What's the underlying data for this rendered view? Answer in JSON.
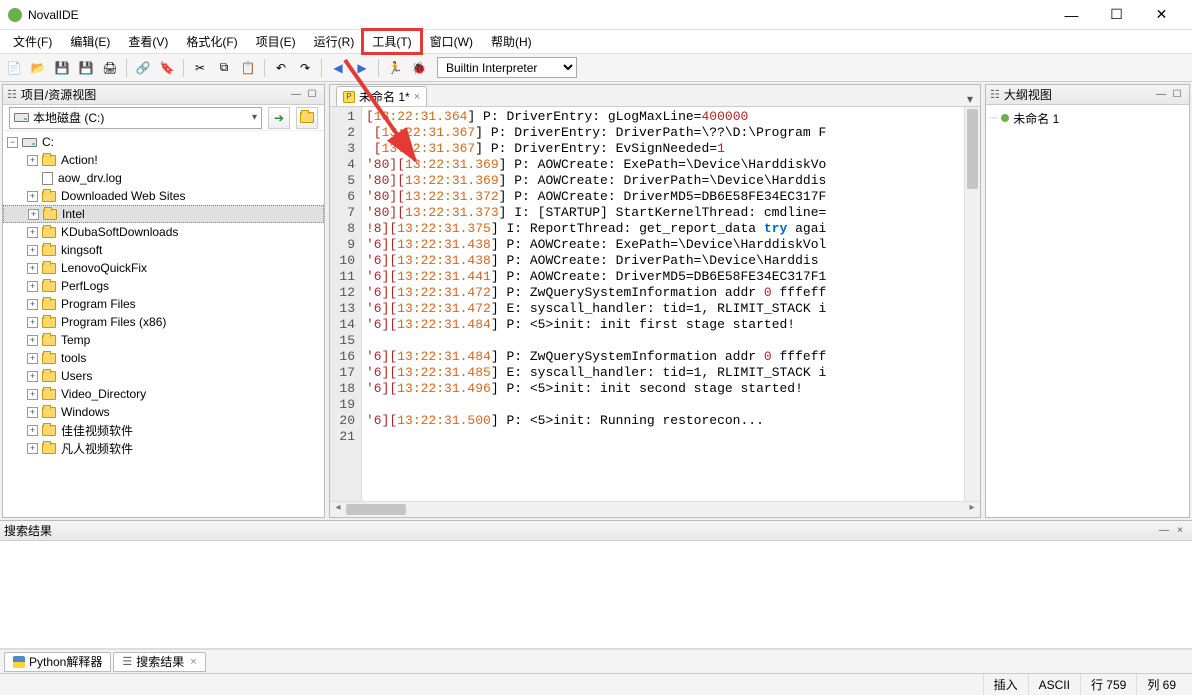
{
  "app": {
    "title": "NovalIDE"
  },
  "window_controls": {
    "min": "—",
    "max": "☐",
    "close": "✕"
  },
  "menu": [
    {
      "key": "file",
      "label": "文件(F)"
    },
    {
      "key": "edit",
      "label": "编辑(E)"
    },
    {
      "key": "view",
      "label": "查看(V)"
    },
    {
      "key": "format",
      "label": "格式化(F)"
    },
    {
      "key": "project",
      "label": "项目(E)"
    },
    {
      "key": "run",
      "label": "运行(R)"
    },
    {
      "key": "tools",
      "label": "工具(T)",
      "highlighted": true
    },
    {
      "key": "window",
      "label": "窗口(W)"
    },
    {
      "key": "help",
      "label": "帮助(H)"
    }
  ],
  "toolbar": {
    "interpreter_selected": "Builtin Interpreter",
    "icons": [
      "new-file-icon",
      "open-folder-icon",
      "save-icon",
      "save-all-icon",
      "print-icon",
      "sep",
      "goto-icon",
      "bookmark-icon",
      "sep",
      "cut-icon",
      "copy-icon",
      "paste-icon",
      "sep",
      "undo-icon",
      "redo-icon",
      "sep",
      "nav-back-icon",
      "nav-fwd-icon",
      "sep",
      "run-icon",
      "bug-icon"
    ]
  },
  "left_panel": {
    "title": "项目/资源视图",
    "drive_label": "本地磁盘 (C:)",
    "tree_root_label": "C:",
    "nodes": [
      {
        "type": "folder",
        "label": "Action!",
        "expandable": true
      },
      {
        "type": "file",
        "label": "aow_drv.log",
        "expandable": false
      },
      {
        "type": "folder",
        "label": "Downloaded Web Sites",
        "expandable": true
      },
      {
        "type": "folder",
        "label": "Intel",
        "expandable": true,
        "selected": true
      },
      {
        "type": "folder",
        "label": "KDubaSoftDownloads",
        "expandable": true
      },
      {
        "type": "folder",
        "label": "kingsoft",
        "expandable": true
      },
      {
        "type": "folder",
        "label": "LenovoQuickFix",
        "expandable": true
      },
      {
        "type": "folder",
        "label": "PerfLogs",
        "expandable": true
      },
      {
        "type": "folder",
        "label": "Program Files",
        "expandable": true
      },
      {
        "type": "folder",
        "label": "Program Files (x86)",
        "expandable": true
      },
      {
        "type": "folder",
        "label": "Temp",
        "expandable": true
      },
      {
        "type": "folder",
        "label": "tools",
        "expandable": true
      },
      {
        "type": "folder",
        "label": "Users",
        "expandable": true
      },
      {
        "type": "folder",
        "label": "Video_Directory",
        "expandable": true
      },
      {
        "type": "folder",
        "label": "Windows",
        "expandable": true
      },
      {
        "type": "folder",
        "label": "佳佳视频软件",
        "expandable": true
      },
      {
        "type": "folder",
        "label": "凡人视频软件",
        "expandable": true
      }
    ]
  },
  "editor": {
    "tab_label": "未命名 1*",
    "lines": [
      {
        "n": 1,
        "pre": "[",
        "ts": "13:22:31.364",
        "rest": "] P: DriverEntry: gLogMaxLine=",
        "num": "400000"
      },
      {
        "n": 2,
        "pre": " [",
        "ts": "13:22:31.367",
        "rest": "] P: DriverEntry: DriverPath=\\??\\D:\\Program F"
      },
      {
        "n": 3,
        "pre": " [",
        "ts": "13:22:31.367",
        "rest": "] P: DriverEntry: EvSignNeeded=",
        "num": "1"
      },
      {
        "n": 4,
        "pre": "'80][",
        "ts": "13:22:31.369",
        "rest": "] P: AOWCreate: ExePath=\\Device\\HarddiskVo"
      },
      {
        "n": 5,
        "pre": "'80][",
        "ts": "13:22:31.369",
        "rest": "] P: AOWCreate: DriverPath=\\Device\\Harddis"
      },
      {
        "n": 6,
        "pre": "'80][",
        "ts": "13:22:31.372",
        "rest": "] P: AOWCreate: DriverMD5=DB6E58FE34EC317F"
      },
      {
        "n": 7,
        "pre": "'80][",
        "ts": "13:22:31.373",
        "rest": "] I: [STARTUP] StartKernelThread: cmdline="
      },
      {
        "n": 8,
        "pre": "!8][",
        "ts": "13:22:31.375",
        "rest": "] I: ReportThread: get_report_data ",
        "kw": "try",
        "tail": " agai"
      },
      {
        "n": 9,
        "pre": "'6][",
        "ts": "13:22:31.438",
        "rest": "] P: AOWCreate: ExePath=\\Device\\HarddiskVol"
      },
      {
        "n": 10,
        "pre": "'6][",
        "ts": "13:22:31.438",
        "rest": "] P: AOWCreate: DriverPath=\\Device\\Harddis"
      },
      {
        "n": 11,
        "pre": "'6][",
        "ts": "13:22:31.441",
        "rest": "] P: AOWCreate: DriverMD5=DB6E58FE34EC317F1"
      },
      {
        "n": 12,
        "pre": "'6][",
        "ts": "13:22:31.472",
        "rest": "] P: ZwQuerySystemInformation addr ",
        "num": "0",
        "tail": " fffeff"
      },
      {
        "n": 13,
        "pre": "'6][",
        "ts": "13:22:31.472",
        "rest": "] E: syscall_handler: tid=1, RLIMIT_STACK i"
      },
      {
        "n": 14,
        "pre": "'6][",
        "ts": "13:22:31.484",
        "rest": "] P: <5>init: init first stage started!"
      },
      {
        "n": 15,
        "pre": "",
        "ts": "",
        "rest": ""
      },
      {
        "n": 16,
        "pre": "'6][",
        "ts": "13:22:31.484",
        "rest": "] P: ZwQuerySystemInformation addr ",
        "num": "0",
        "tail": " fffeff"
      },
      {
        "n": 17,
        "pre": "'6][",
        "ts": "13:22:31.485",
        "rest": "] E: syscall_handler: tid=1, RLIMIT_STACK i"
      },
      {
        "n": 18,
        "pre": "'6][",
        "ts": "13:22:31.496",
        "rest": "] P: <5>init: init second stage started!"
      },
      {
        "n": 19,
        "pre": "",
        "ts": "",
        "rest": ""
      },
      {
        "n": 20,
        "pre": "'6][",
        "ts": "13:22:31.500",
        "rest": "] P: <5>init: Running restorecon..."
      },
      {
        "n": 21,
        "pre": "",
        "ts": "",
        "rest": ""
      }
    ]
  },
  "right_panel": {
    "title": "大纲视图",
    "item_label": "未命名 1"
  },
  "bottom_panel": {
    "title": "搜索结果"
  },
  "bottom_tabs": {
    "python_label": "Python解释器",
    "search_label": "搜索结果"
  },
  "statusbar": {
    "mode": "插入",
    "encoding": "ASCII",
    "line_label": "行 759",
    "col_label": "列 69"
  }
}
